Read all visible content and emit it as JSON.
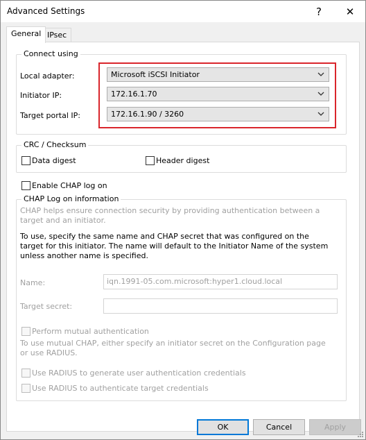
{
  "window": {
    "title": "Advanced Settings",
    "help_label": "?",
    "close_label": "✕"
  },
  "tabs": [
    {
      "label": "General",
      "active": true
    },
    {
      "label": "IPsec",
      "active": false
    }
  ],
  "connect": {
    "group_title": "Connect using",
    "local_adapter_label": "Local adapter:",
    "local_adapter_value": "Microsoft iSCSI Initiator",
    "initiator_ip_label": "Initiator IP:",
    "initiator_ip_value": "172.16.1.70",
    "target_portal_label": "Target portal IP:",
    "target_portal_value": "172.16.1.90 / 3260"
  },
  "crc": {
    "group_title": "CRC / Checksum",
    "data_digest_label": "Data digest",
    "header_digest_label": "Header digest"
  },
  "chap": {
    "enable_label": "Enable CHAP log on",
    "group_title": "CHAP Log on information",
    "help_text": "CHAP helps ensure connection security by providing authentication between a target and an initiator.",
    "instructions": "To use, specify the same name and CHAP secret that was configured on the target for this initiator.  The name will default to the Initiator Name of the system unless another name is specified.",
    "name_label": "Name:",
    "name_value": "iqn.1991-05.com.microsoft:hyper1.cloud.local",
    "secret_label": "Target secret:",
    "secret_value": "",
    "mutual_label": "Perform mutual authentication",
    "mutual_help": "To use mutual CHAP, either specify an initiator secret on the Configuration page or use RADIUS.",
    "radius_user_label": "Use RADIUS to generate user authentication credentials",
    "radius_target_label": "Use RADIUS to authenticate target credentials"
  },
  "buttons": {
    "ok": "OK",
    "cancel": "Cancel",
    "apply": "Apply"
  },
  "colors": {
    "highlight_border": "#d9252b",
    "default_button_border": "#0078d7"
  }
}
